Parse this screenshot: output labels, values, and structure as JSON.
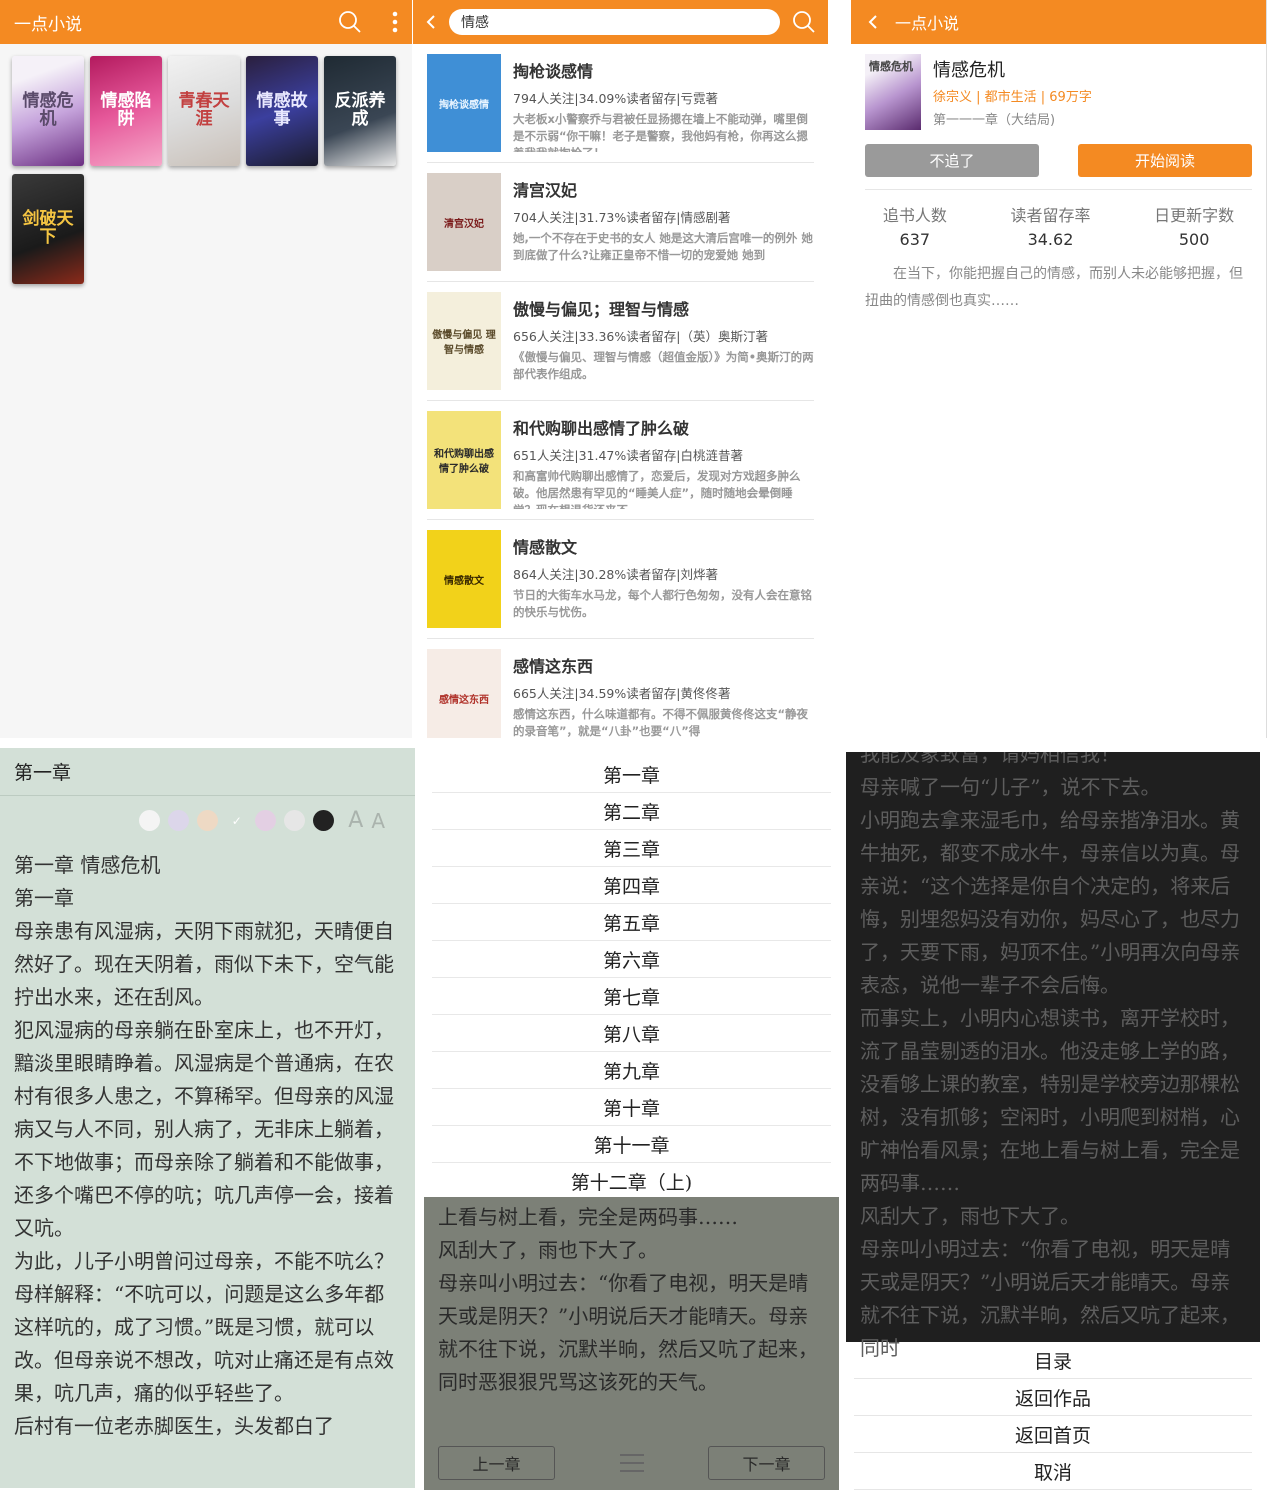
{
  "shelf": {
    "brand": "一点小说",
    "books": [
      {
        "cover_text": "情感危机",
        "bg": "linear-gradient(160deg,#f5f1f8 20%,#c6a4dc 55%,#6b2f82 100%)",
        "fg": "#5a4a6a"
      },
      {
        "cover_text": "情感陷阱",
        "bg": "linear-gradient(160deg,#b31a5e 0%,#e6589a 50%,#f6a8c9 100%)",
        "fg": "#ffffff"
      },
      {
        "cover_text": "青春天涯",
        "bg": "linear-gradient(160deg,#f2f2f2 0%,#dcdcdc 50%,#c9c0b8 100%)",
        "fg": "#c24040"
      },
      {
        "cover_text": "情感故事",
        "bg": "linear-gradient(160deg,#2a1f3d 0%,#3b3f9e 50%,#1b1b2b 100%)",
        "fg": "#e8e8ff"
      },
      {
        "cover_text": "反派养成",
        "bg": "linear-gradient(160deg,#1f2a33 0%,#3a4654 60%,#e9e9e9 100%)",
        "fg": "#ffffff"
      },
      {
        "cover_text": "剑破天下",
        "bg": "linear-gradient(160deg,#3a3a3a 0%,#1a1a1a 60%,#8c2a1a 100%)",
        "fg": "#f5c542"
      }
    ]
  },
  "search": {
    "query": "情感",
    "results": [
      {
        "title": "掏枪谈感情",
        "meta": "794人关注|34.09%读者留存|亏霓著",
        "desc": "大老板x小警察乔与君被任显扬摁在墙上不能动弹，嘴里倒是不示弱“你干嘛！老子是警察，我他妈有枪，你再这么摁着我我就掏枪了！",
        "cover_text": "掏枪谈感情",
        "bg": "#3f8fd6",
        "fg": "#e8f4ff"
      },
      {
        "title": "清宫汉妃",
        "meta": "704人关注|31.73%读者留存|情感剧著",
        "desc": "她,一个不存在于史书的女人 她是这大清后宫唯一的例外 她到底做了什么?让雍正皇帝不惜一切的宠爱她 她到",
        "cover_text": "清宫汉妃",
        "bg": "#d9cfc7",
        "fg": "#7a1a1a"
      },
      {
        "title": "傲慢与偏见；理智与情感",
        "meta": "656人关注|33.36%读者留存|（英）奥斯汀著",
        "desc": "《傲慢与偏见、理智与情感（超值金版）》为简•奥斯汀的两部代表作组成。",
        "cover_text": "傲慢与偏见 理智与情感",
        "bg": "#f4efdc",
        "fg": "#5a4a2a"
      },
      {
        "title": "和代购聊出感情了肿么破",
        "meta": "651人关注|31.47%读者留存|白桃涟昔著",
        "desc": "和高富帅代购聊出感情了，恋爱后，发现对方戏超多肿么破。他居然患有罕见的“睡美人症”，随时随地会晕倒睡觉？现在想退货还来不",
        "cover_text": "和代购聊出感情了肿么破",
        "bg": "#f3e27a",
        "fg": "#2a2a2a"
      },
      {
        "title": "情感散文",
        "meta": "864人关注|30.28%读者留存|刘烨著",
        "desc": "节日的大街车水马龙，每个人都行色匆匆，没有人会在意铭的快乐与忧伤。",
        "cover_text": "情感散文",
        "bg": "#f2d21a",
        "fg": "#3a2a00"
      },
      {
        "title": "感情这东西",
        "meta": "665人关注|34.59%读者留存|黄佟佟著",
        "desc": "感情这东西，什么味道都有。不得不佩服黄佟佟这支“静夜的录音笔”，就是“八卦”也要“八”得",
        "cover_text": "感情这东西",
        "bg": "#f6ece6",
        "fg": "#b0322a"
      }
    ]
  },
  "detail": {
    "brand": "一点小说",
    "title": "情感危机",
    "author_line": "徐宗义 | 都市生活 | 69万字",
    "chapter_line": "第一一一章（大结局)",
    "cover_text": "情感危机",
    "btn_unfollow": "不追了",
    "btn_read": "开始阅读",
    "stats": [
      {
        "label": "追书人数",
        "value": "637"
      },
      {
        "label": "读者留存率",
        "value": "34.62"
      },
      {
        "label": "日更新字数",
        "value": "500"
      }
    ],
    "synopsis": "在当下，你能把握自己的情感，而别人未必能够把握，但扭曲的情感倒也真实……"
  },
  "reader": {
    "chapter": "第一章",
    "swatch_colors": [
      "#f4f4f4",
      "#dcd6ea",
      "#eed9c4",
      "#d3e0d7",
      "#e3cfe3",
      "#e6e6e6",
      "#222222"
    ],
    "font_small": "A",
    "font_large": "A",
    "paragraphs": [
      "第一章 情感危机",
      "第一章",
      "母亲患有风湿病，天阴下雨就犯，天晴便自然好了。现在天阴着，雨似下未下，空气能拧出水来，还在刮风。",
      "犯风湿病的母亲躺在卧室床上，也不开灯，黯淡里眼睛睁着。风湿病是个普通病，在农村有很多人患之，不算稀罕。但母亲的风湿病又与人不同，别人病了，无非床上躺着，不下地做事；而母亲除了躺着和不能做事，还多个嘴巴不停的吭；吭几声停一会，接着又吭。",
      "为此，儿子小明曾问过母亲，不能不吭么？",
      "母样解释：“不吭可以，问题是这么多年都这样吭的，成了习惯。”既是习惯，就可以改。但母亲说不想改，吭对止痛还是有点效果，吭几声，痛的似乎轻些了。",
      "后村有一位老赤脚医生，头发都白了"
    ]
  },
  "chapters": {
    "items": [
      "第一章",
      "第二章",
      "第三章",
      "第四章",
      "第五章",
      "第六章",
      "第七章",
      "第八章",
      "第九章",
      "第十章",
      "第十一章",
      "第十二章（上)"
    ],
    "dim_paragraphs": [
      "上看与树上看，完全是两码事……",
      "风刮大了，雨也下大了。",
      "母亲叫小明过去：“你看了电视，明天是晴天或是阴天？”小明说后天才能晴天。母亲就不往下说，沉默半晌，然后又吭了起来，同时恶狠狠咒骂这该死的天气。"
    ],
    "prev": "上一章",
    "next": "下一章"
  },
  "night": {
    "paragraphs": [
      "我能及象致富，请妈相信我！",
      "母亲喊了一句“儿子”，说不下去。",
      "小明跑去拿来湿毛巾，给母亲揩净泪水。黄牛抽死，都变不成水牛，母亲信以为真。母亲说：“这个选择是你自个决定的，将来后悔，别埋怨妈没有劝你，妈尽心了，也尽力了，天要下雨，妈顶不住。”小明再次向母亲表态，说他一辈子不会后悔。",
      "而事实上，小明内心想读书，离开学校时，流了晶莹剔透的泪水。他没走够上学的路，没看够上课的教室，特别是学校旁边那棵松树，没有抓够；空闲时，小明爬到树梢，心旷神怡看风景；在地上看与树上看，完全是两码事……",
      "风刮大了，雨也下大了。",
      "母亲叫小明过去：“你看了电视，明天是晴天或是阴天？”小明说后天才能晴天。母亲就不往下说，沉默半晌，然后又吭了起来，同时"
    ],
    "menu": [
      "目录",
      "返回作品",
      "返回首页",
      "取消"
    ]
  }
}
